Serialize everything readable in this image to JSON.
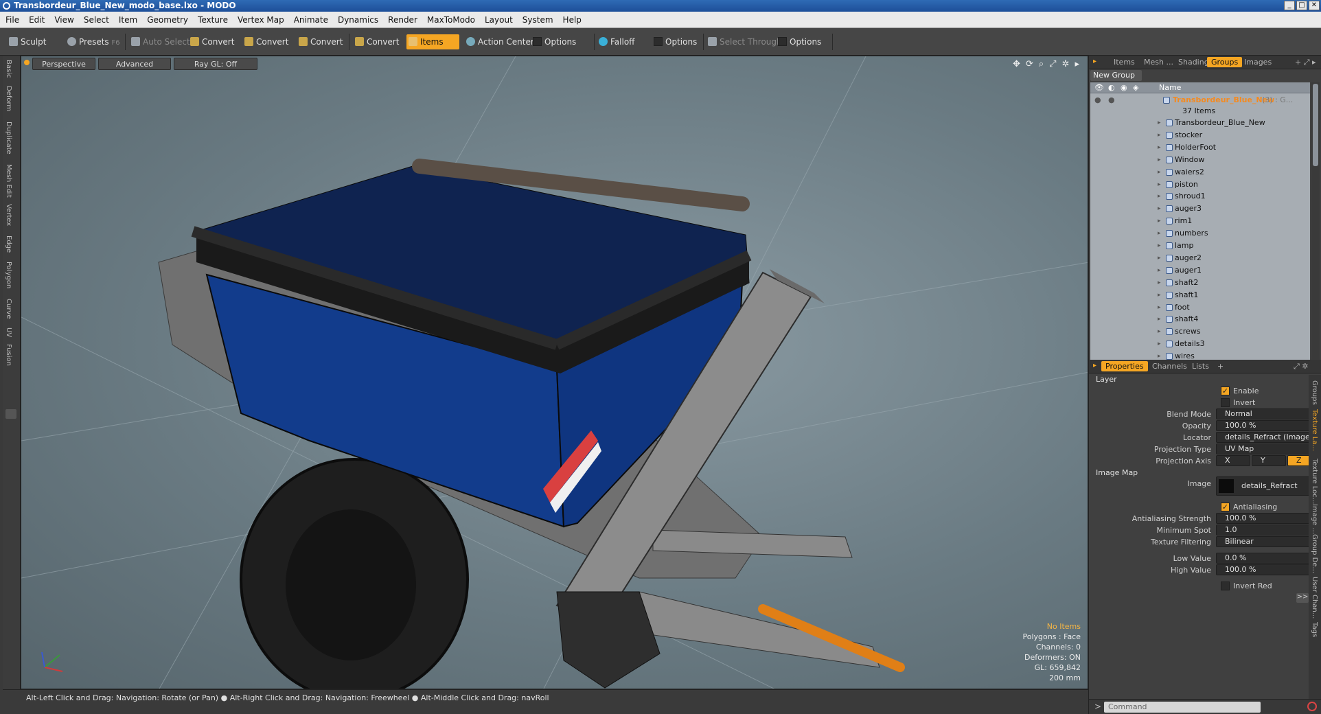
{
  "window": {
    "title": "Transbordeur_Blue_New_modo_base.lxo - MODO"
  },
  "menu": [
    "File",
    "Edit",
    "View",
    "Select",
    "Item",
    "Geometry",
    "Texture",
    "Vertex Map",
    "Animate",
    "Dynamics",
    "Render",
    "MaxToModo",
    "Layout",
    "System",
    "Help"
  ],
  "toolbar": {
    "sculpt": "Sculpt",
    "presets": "Presets",
    "presets_key": "F6",
    "auto_select": "Auto Select",
    "convert": "Convert",
    "items": "Items",
    "action_center": "Action Center",
    "options": "Options",
    "falloff": "Falloff",
    "select_through": "Select Through"
  },
  "left_tabs": [
    "Basic",
    "Deform",
    "Duplicate",
    "Mesh Edit",
    "Vertex",
    "Edge",
    "Polygon",
    "Curve",
    "UV",
    "Fusion"
  ],
  "viewport": {
    "perspective": "Perspective",
    "advanced": "Advanced",
    "raygl": "Ray GL: Off"
  },
  "stats": {
    "no_items": "No Items",
    "polygons": "Polygons : Face",
    "channels": "Channels: 0",
    "deformers": "Deformers: ON",
    "gl": "GL: 659,842",
    "size": "200 mm"
  },
  "status": "Alt-Left Click and Drag: Navigation: Rotate (or Pan) ● Alt-Right Click and Drag: Navigation: Freewheel ● Alt-Middle Click and Drag: navRoll",
  "panel_tabs": [
    "Items",
    "Mesh ...",
    "Shading",
    "Groups",
    "Images"
  ],
  "new_group": "New Group",
  "list": {
    "name_header": "Name",
    "root": "Transbordeur_Blue_New",
    "root_count": "(3) : G...",
    "root_items": "37 Items",
    "items": [
      "Transbordeur_Blue_New",
      "stocker",
      "HolderFoot",
      "Window",
      "waiers2",
      "piston",
      "shroud1",
      "auger3",
      "rim1",
      "numbers",
      "lamp",
      "auger2",
      "auger1",
      "shaft2",
      "shaft1",
      "foot",
      "shaft4",
      "screws",
      "details3",
      "wires"
    ]
  },
  "prop_tabs": [
    "Properties",
    "Channels",
    "Lists"
  ],
  "props": {
    "layer": "Layer",
    "enable": "Enable",
    "invert": "Invert",
    "blend_mode_label": "Blend Mode",
    "blend_mode": "Normal",
    "opacity_label": "Opacity",
    "opacity": "100.0 %",
    "locator_label": "Locator",
    "locator": "details_Refract (Image) (Texture)",
    "proj_type_label": "Projection Type",
    "proj_type": "UV Map",
    "proj_axis_label": "Projection Axis",
    "axis_x": "X",
    "axis_y": "Y",
    "axis_z": "Z",
    "image_map": "Image Map",
    "image_label": "Image",
    "image": "details_Refract",
    "antialiasing": "Antialiasing",
    "aa_strength_label": "Antialiasing Strength",
    "aa_strength": "100.0 %",
    "min_spot_label": "Minimum Spot",
    "min_spot": "1.0",
    "tex_filter_label": "Texture Filtering",
    "tex_filter": "Bilinear",
    "low_label": "Low Value",
    "low": "0.0 %",
    "high_label": "High Value",
    "high": "100.0 %",
    "invert_red": "Invert Red"
  },
  "right_tabs": [
    "Groups",
    "Texture La...",
    "Texture Loc...",
    "Image ...",
    "Group De...",
    "User Chan...",
    "Tags"
  ],
  "command": {
    "placeholder": "Command"
  }
}
